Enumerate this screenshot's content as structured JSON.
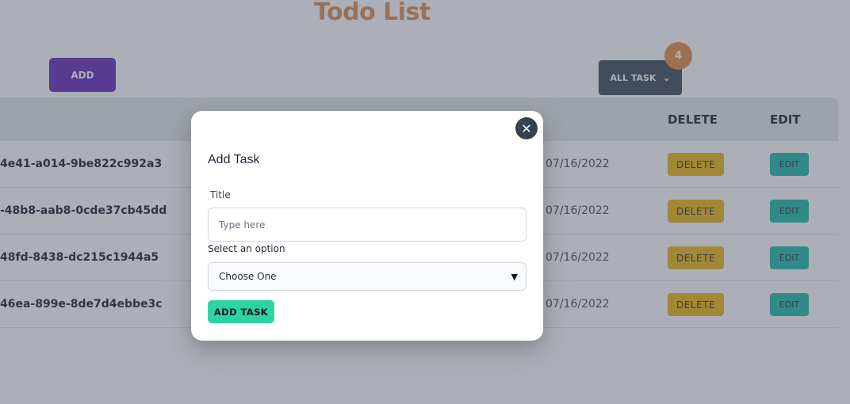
{
  "app": {
    "title": "Todo List",
    "add_label": "ADD",
    "filter_label": "ALL TASK",
    "filter_icon": "chevron-down-icon",
    "task_count": "4",
    "colors": {
      "title": "#d9884a",
      "add_button": "#5b21b6",
      "filter_button": "#374151",
      "count_badge": "#e0893c",
      "delete_button": "#eab308",
      "edit_button": "#14b8a6",
      "add_task_button": "#2dd4a3"
    }
  },
  "table": {
    "headers": {
      "delete": "DELETE",
      "edit": "EDIT"
    },
    "rows": [
      {
        "id": "4e41-a014-9be822c992a3",
        "date": "07/16/2022",
        "delete_label": "DELETE",
        "edit_label": "EDIT"
      },
      {
        "id": "-48b8-aab8-0cde37cb45dd",
        "date": "07/16/2022",
        "delete_label": "DELETE",
        "edit_label": "EDIT"
      },
      {
        "id": "48fd-8438-dc215c1944a5",
        "date": "07/16/2022",
        "delete_label": "DELETE",
        "edit_label": "EDIT"
      },
      {
        "id": "46ea-899e-8de7d4ebbe3c",
        "date": "07/16/2022",
        "delete_label": "DELETE",
        "edit_label": "EDIT"
      }
    ]
  },
  "modal": {
    "close_icon": "close-icon",
    "title": "Add Task",
    "title_label": "Title",
    "title_placeholder": "Type here",
    "title_value": "",
    "select_label": "Select an option",
    "select_value": "Choose One",
    "submit_label": "ADD TASK"
  }
}
